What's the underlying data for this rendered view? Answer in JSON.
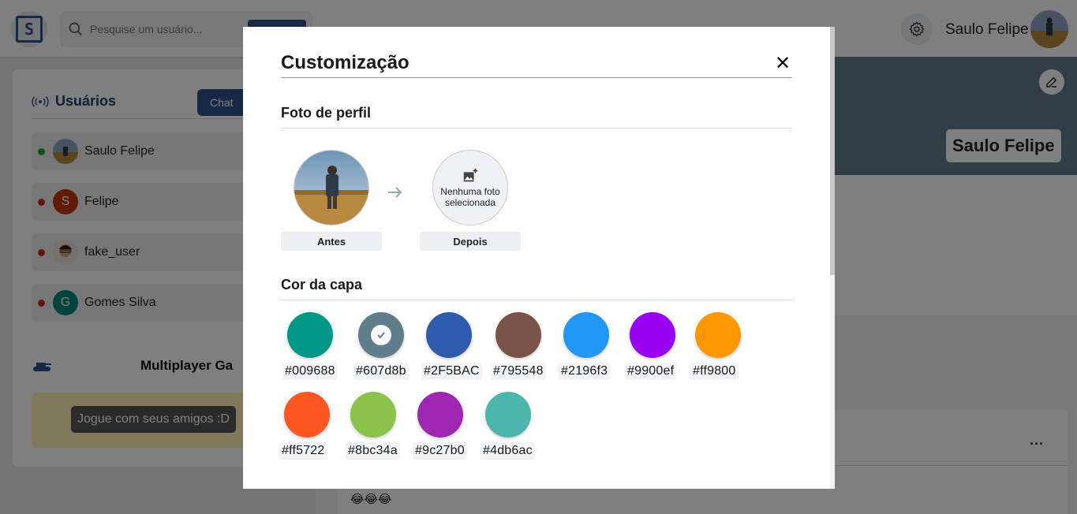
{
  "header": {
    "logo_text": "S",
    "search_placeholder": "Pesquise um usuário...",
    "user_name": "Saulo Felipe",
    "icons": {
      "search": "search-icon",
      "settings": "gear-icon"
    }
  },
  "sidebar": {
    "users_title": "Usuários",
    "chat_button": "Chat",
    "users": [
      {
        "name": "Saulo Felipe",
        "status": "online",
        "status_color": "#1e9e3a",
        "avatar": "photo",
        "avatar_letter": ""
      },
      {
        "name": "Felipe",
        "status": "offline",
        "status_color": "#c62828",
        "avatar": "letter",
        "avatar_letter": "S",
        "avatar_color": "#bf360c"
      },
      {
        "name": "fake_user",
        "status": "offline",
        "status_color": "#c62828",
        "avatar": "photo-person",
        "avatar_letter": ""
      },
      {
        "name": "Gomes Silva",
        "status": "offline",
        "status_color": "#c62828",
        "avatar": "letter",
        "avatar_letter": "G",
        "avatar_color": "#00897b"
      }
    ],
    "game_title": "Multiplayer Ga",
    "game_tooltip": "Jogue com seus amigos :D"
  },
  "profile": {
    "name": "Saulo Felipe",
    "cover_color": "#607d8b"
  },
  "feed": {
    "post_menu": "...",
    "post_content": "😂😂😂"
  },
  "modal": {
    "title": "Customização",
    "close_label": "✕",
    "photo_section": {
      "title": "Foto de perfil",
      "before_label": "Antes",
      "after_label": "Depois",
      "empty_text": "Nenhuma foto selecionada"
    },
    "cover_section": {
      "title": "Cor da capa",
      "selected": "#607d8b",
      "colors": [
        {
          "hex": "#009688",
          "label": "#009688"
        },
        {
          "hex": "#607d8b",
          "label": "#607d8b"
        },
        {
          "hex": "#2F5BAC",
          "label": "#2F5BAC"
        },
        {
          "hex": "#795548",
          "label": "#795548"
        },
        {
          "hex": "#2196f3",
          "label": "#2196f3"
        },
        {
          "hex": "#9900ef",
          "label": "#9900ef"
        },
        {
          "hex": "#ff9800",
          "label": "#ff9800"
        },
        {
          "hex": "#ff5722",
          "label": "#ff5722"
        },
        {
          "hex": "#8bc34a",
          "label": "#8bc34a"
        },
        {
          "hex": "#9c27b0",
          "label": "#9c27b0"
        },
        {
          "hex": "#4db6ac",
          "label": "#4db6ac"
        }
      ]
    }
  }
}
